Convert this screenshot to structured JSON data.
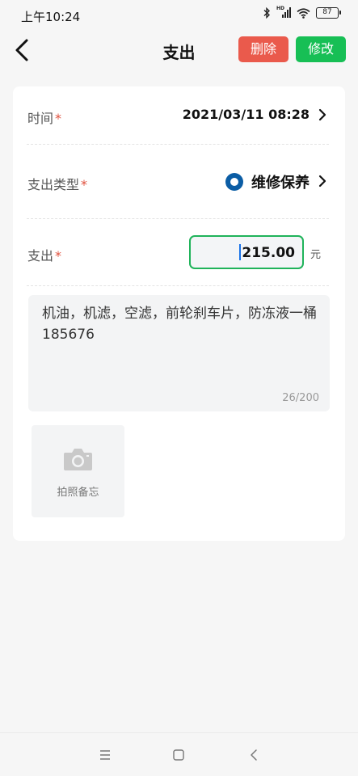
{
  "status_bar": {
    "time": "上午10:24",
    "network_label": "HD",
    "battery": "87"
  },
  "header": {
    "title": "支出",
    "delete_label": "删除",
    "edit_label": "修改",
    "delete_color": "#ea5a4c",
    "edit_color": "#17bf55"
  },
  "form": {
    "time": {
      "label": "时间",
      "required_mark": "*",
      "value": "2021/03/11 08:28"
    },
    "type": {
      "label": "支出类型",
      "required_mark": "*",
      "value": "维修保养",
      "icon": "repair-type-icon",
      "icon_color": "#0b5da5"
    },
    "amount": {
      "label": "支出",
      "required_mark": "*",
      "value": "215.00",
      "unit": "元"
    },
    "remark": {
      "text": "机油，机滤，空滤，前轮刹车片，防冻液一桶185676",
      "counter": "26/200"
    },
    "photo": {
      "label": "拍照备忘",
      "icon": "camera-icon"
    }
  },
  "system_nav": {
    "icons": [
      "menu-icon",
      "home-icon",
      "back-icon"
    ]
  }
}
